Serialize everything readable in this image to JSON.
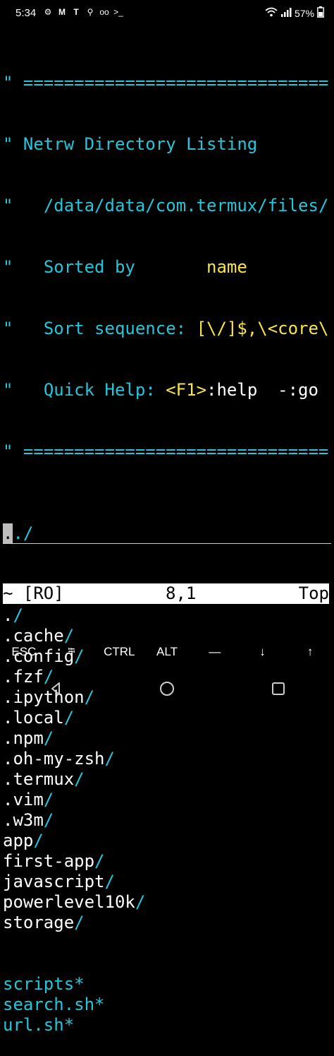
{
  "status_bar": {
    "time": "5:34",
    "battery_percent": "57%",
    "left_icons": [
      "gear-icon",
      "gmail-icon",
      "tmobile-icon",
      "location-icon",
      "voicemail-icon",
      "terminal-prompt-icon"
    ],
    "right_icons": [
      "wifi-icon",
      "signal-icon",
      "battery-icon"
    ],
    "icon_glyphs": {
      "gear": "⚙",
      "gmail": "M",
      "tmobile": "T",
      "location": "⚲",
      "voicemail": "oo",
      "terminal": ">_"
    }
  },
  "netrw_header": {
    "comment_mark": "\"",
    "separator": " ==============================",
    "title": "Netrw Directory Listing",
    "path": "/data/data/com.termux/files/",
    "sorted_by_label": "Sorted by",
    "sorted_by_value": "name",
    "sort_sequence_label": "Sort sequence:",
    "sort_sequence_value": "[\\/]$,\\<core\\",
    "quick_help_label": "Quick Help:",
    "quick_help_key": "<F1>",
    "quick_help_rest": ":help  -:go"
  },
  "listing": {
    "cursor_entry": {
      "cursor_char": ".",
      "rest": "./"
    },
    "entries": [
      {
        "name": ".",
        "suffix": "/"
      },
      {
        "name": ".cache",
        "suffix": "/"
      },
      {
        "name": ".config",
        "suffix": "/"
      },
      {
        "name": ".fzf",
        "suffix": "/"
      },
      {
        "name": ".ipython",
        "suffix": "/"
      },
      {
        "name": ".local",
        "suffix": "/"
      },
      {
        "name": ".npm",
        "suffix": "/"
      },
      {
        "name": ".oh-my-zsh",
        "suffix": "/"
      },
      {
        "name": ".termux",
        "suffix": "/"
      },
      {
        "name": ".vim",
        "suffix": "/"
      },
      {
        "name": ".w3m",
        "suffix": "/"
      },
      {
        "name": "app",
        "suffix": "/"
      },
      {
        "name": "first-app",
        "suffix": "/"
      },
      {
        "name": "javascript",
        "suffix": "/"
      },
      {
        "name": "powerlevel10k",
        "suffix": "/"
      },
      {
        "name": "storage",
        "suffix": "/"
      }
    ],
    "executables": [
      {
        "name": "scripts*"
      },
      {
        "name": "search.sh*"
      },
      {
        "name": "url.sh*"
      }
    ]
  },
  "vim_status": {
    "left": "~ [RO]",
    "position": "8,1",
    "scroll": "Top"
  },
  "extra_keys": [
    "ESC",
    "⭾",
    "CTRL",
    "ALT",
    "—",
    "↓",
    "↑"
  ],
  "colors": {
    "background": "#000000",
    "cyan": "#26c6da",
    "yellow": "#f9e548",
    "white": "#ffffff"
  }
}
